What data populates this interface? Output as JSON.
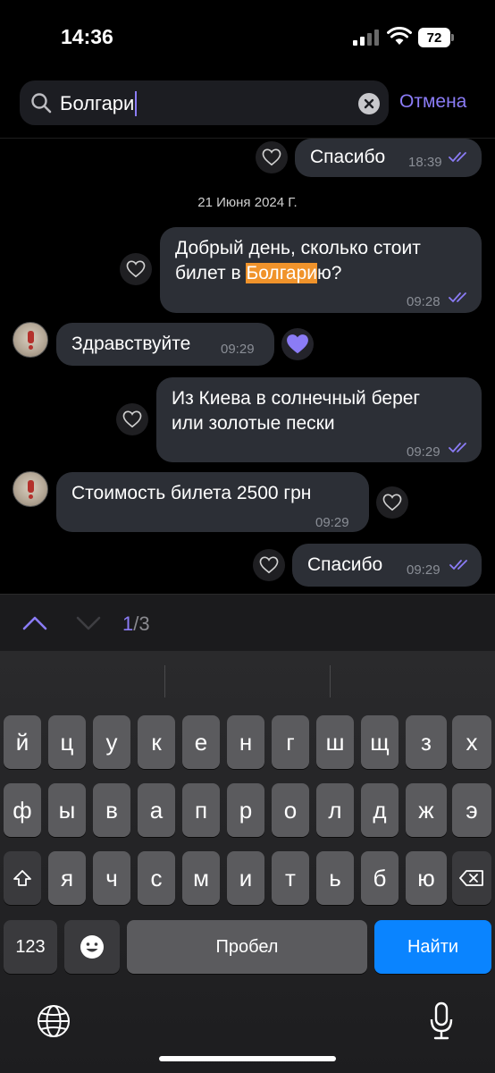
{
  "status_bar": {
    "time": "14:36",
    "battery": "72"
  },
  "search": {
    "query": "Болгари",
    "cancel_label": "Отмена"
  },
  "chat": {
    "date_separator": "21 Июня 2024 Г.",
    "messages": [
      {
        "id": "m0",
        "side": "out",
        "text": "Спасибо",
        "time": "18:39"
      },
      {
        "id": "m1",
        "side": "out",
        "text_line1": "Добрый день, сколько стоит",
        "text_line2_before": "билет в ",
        "text_line2_highlight": "Болгари",
        "text_line2_after": "ю?",
        "time": "09:28"
      },
      {
        "id": "m2",
        "side": "in",
        "text": "Здравствуйте",
        "time": "09:29",
        "liked": true
      },
      {
        "id": "m3",
        "side": "out",
        "text_line1": "Из Киева в солнечный берег",
        "text_line2": "или золотые пески",
        "time": "09:29"
      },
      {
        "id": "m4",
        "side": "in",
        "text": "Стоимость билета 2500 грн",
        "time": "09:29"
      },
      {
        "id": "m5",
        "side": "out",
        "text": "Спасибо",
        "time": "09:29"
      }
    ]
  },
  "search_nav": {
    "current": "1",
    "separator": "/",
    "total": "3"
  },
  "keyboard": {
    "row1": [
      "й",
      "ц",
      "у",
      "к",
      "е",
      "н",
      "г",
      "ш",
      "щ",
      "з",
      "х"
    ],
    "row2": [
      "ф",
      "ы",
      "в",
      "а",
      "п",
      "р",
      "о",
      "л",
      "д",
      "ж",
      "э"
    ],
    "row3": [
      "я",
      "ч",
      "с",
      "м",
      "и",
      "т",
      "ь",
      "б",
      "ю"
    ],
    "numbers_label": "123",
    "space_label": "Пробел",
    "go_label": "Найти"
  },
  "colors": {
    "accent": "#8b7cf6",
    "highlight": "#f0932b",
    "bubble": "#2c2f36",
    "go_key": "#0a84ff"
  }
}
